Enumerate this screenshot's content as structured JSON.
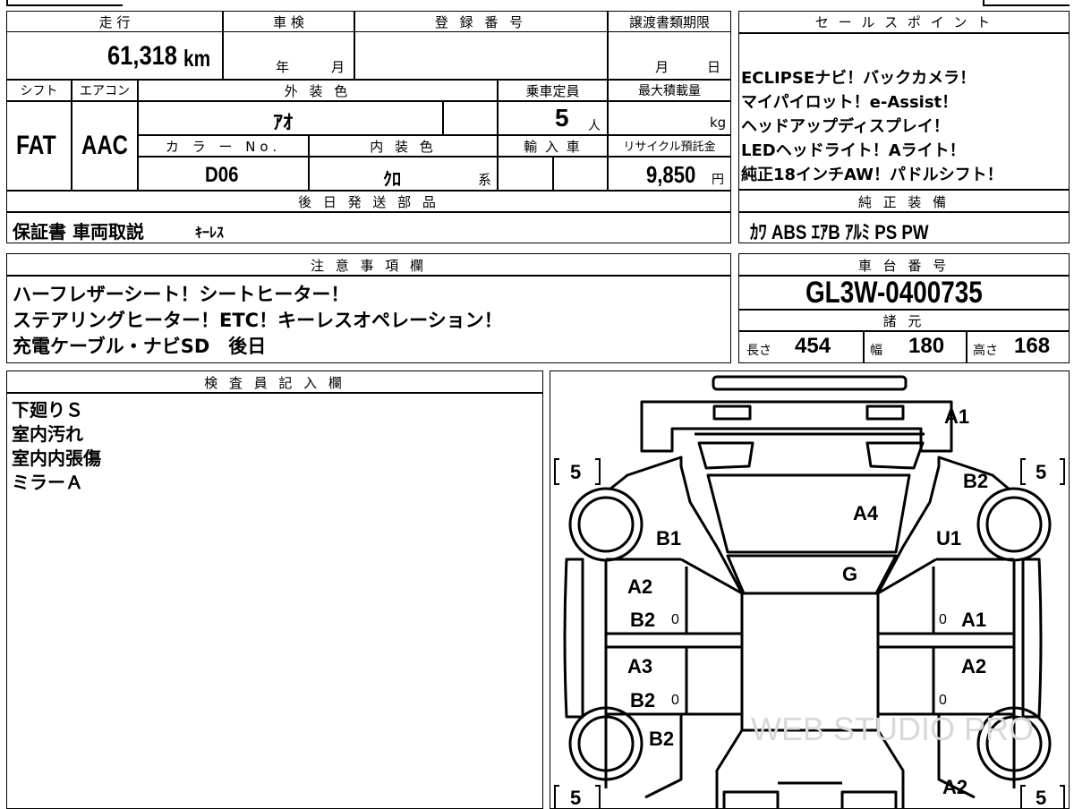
{
  "main_table": {
    "mileage_header": "走 行",
    "mileage_value": "61,318",
    "mileage_unit": "km",
    "inspection_header": "車 検",
    "inspection_year_label": "年",
    "inspection_month_label": "月",
    "registration_header": "登 録 番 号",
    "transfer_deadline_header": "譲渡書類期限",
    "transfer_month_label": "月",
    "transfer_day_label": "日",
    "shift_header": "シフト",
    "shift_value": "FAT",
    "aircon_header": "エアコン",
    "aircon_value": "AAC",
    "exterior_color_header": "外 装 色",
    "exterior_color_value": "ｱｵ",
    "color_no_header": "カ ラ ー No.",
    "color_no_value": "D06",
    "interior_color_header": "内 装 色",
    "interior_color_value": "ｸﾛ",
    "interior_color_suffix": "系",
    "capacity_header": "乗車定員",
    "capacity_value": "5",
    "capacity_unit": "人",
    "max_load_header": "最大積載量",
    "max_load_unit": "kg",
    "import_header": "輸 入 車",
    "recycle_header": "リサイクル預託金",
    "recycle_value": "9,850",
    "recycle_unit": "円",
    "later_parts_header": "後 日 発 送 部 品",
    "later_parts_value1": "保証書 車両取説",
    "later_parts_value2": "ｷｰﾚｽ"
  },
  "sales_points": {
    "header": "セ ー ル ス ポ イ ン ト",
    "lines": [
      "ECLIPSEナビ！バックカメラ！",
      "マイパイロット！e-Assist！",
      "ヘッドアップディスプレイ！",
      "LEDヘッドライト！Aライト！",
      "純正18インチAW！パドルシフト！"
    ]
  },
  "standard_equipment": {
    "header": "純 正 装 備",
    "value": "ｶﾜ ABS ｴｱB ｱﾙﾐ PS PW"
  },
  "notes": {
    "header": "注 意 事 項 欄",
    "lines": [
      "ハーフレザーシート！シートヒーター！",
      "ステアリングヒーター！ETC！キーレスオペレーション！",
      "充電ケーブル・ナビSD　後日"
    ]
  },
  "chassis": {
    "header": "車 台 番 号",
    "value": "GL3W-0400735"
  },
  "specs": {
    "header": "諸 元",
    "length_label": "長さ",
    "length_value": "454",
    "width_label": "幅",
    "width_value": "180",
    "height_label": "高さ",
    "height_value": "168"
  },
  "inspector": {
    "header": "検 査 員 記 入 欄",
    "lines": [
      "下廻りＳ",
      "室内汚れ",
      "室内内張傷",
      "ミラーＡ"
    ]
  },
  "diagram": {
    "tire_label": "5",
    "marks": {
      "front_bumper": "A1",
      "front_right_fender": "B2",
      "front_left_fender": "B1",
      "bonnet": "A4",
      "right_front_pillar": "U1",
      "windshield": "G",
      "left_front_door_1": "A2",
      "left_front_door_2": "B2",
      "left_rear_door_1": "A3",
      "left_rear_door_2": "B2",
      "right_front_door": "A1",
      "right_rear_door": "A2",
      "left_rear_fender": "B2",
      "right_rear_fender": "A2"
    },
    "zero": "0",
    "watermark": "WEB STUDIO PRO"
  }
}
